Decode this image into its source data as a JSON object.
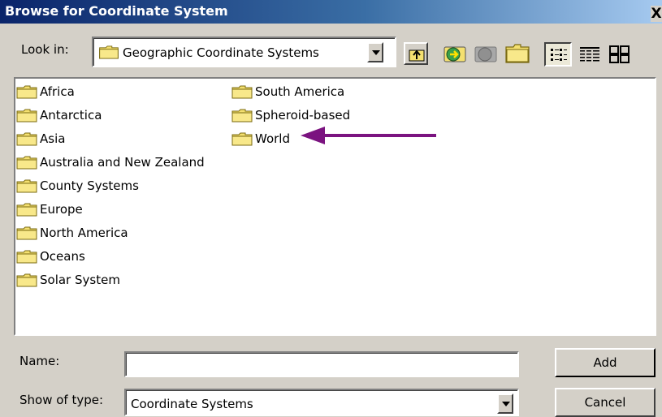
{
  "window": {
    "title": "Browse for Coordinate System",
    "close_glyph": "X"
  },
  "toolbar": {
    "look_in_label": "Look in:",
    "look_in_value": "Geographic Coordinate Systems",
    "icons": [
      "up-one-level-icon",
      "connect-folder-icon",
      "disconnect-folder-icon",
      "new-folder-icon",
      "list-view-icon",
      "details-view-icon",
      "thumbnails-view-icon"
    ]
  },
  "folders": {
    "column1": [
      "Africa",
      "Antarctica",
      "Asia",
      "Australia and New Zealand",
      "County Systems",
      "Europe",
      "North America",
      "Oceans",
      "Solar System"
    ],
    "column2": [
      "South America",
      "Spheroid-based",
      "World"
    ]
  },
  "annotation": {
    "color": "#7b1380",
    "points_to": "World"
  },
  "form": {
    "name_label": "Name:",
    "name_value": "",
    "type_label": "Show of type:",
    "type_value": "Coordinate Systems"
  },
  "buttons": {
    "add": "Add",
    "cancel": "Cancel"
  },
  "colors": {
    "title_bar": "#0a246a",
    "dialog_bg": "#d4d0c8",
    "folder": "#f4e070"
  }
}
